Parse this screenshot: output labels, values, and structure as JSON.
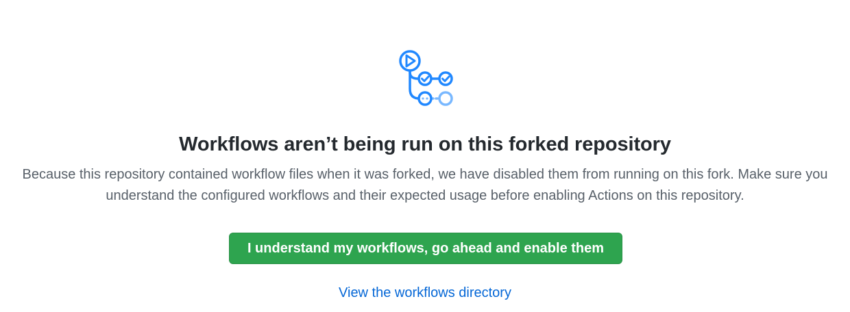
{
  "blankslate": {
    "icon": "workflow-actions-icon",
    "title": "Workflows aren’t being run on this forked repository",
    "description": "Because this repository contained workflow files when it was forked, we have disabled them from running on this fork. Make sure you understand the configured workflows and their expected usage before enabling Actions on this repository.",
    "enable_button_label": "I understand my workflows, go ahead and enable them",
    "view_link_label": "View the workflows directory"
  },
  "colors": {
    "primary_button": "#2ea44f",
    "link": "#0366d6",
    "icon_blue": "#2188ff",
    "icon_light_blue": "#79b8ff",
    "title": "#24292e",
    "muted_text": "#586069"
  }
}
